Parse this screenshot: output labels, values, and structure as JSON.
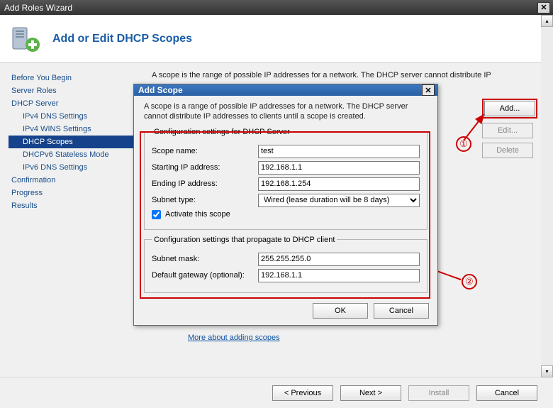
{
  "window": {
    "title": "Add Roles Wizard",
    "header_title": "Add or Edit DHCP Scopes"
  },
  "sidebar": {
    "items": [
      {
        "label": "Before You Begin",
        "sub": false,
        "selected": false
      },
      {
        "label": "Server Roles",
        "sub": false,
        "selected": false
      },
      {
        "label": "DHCP Server",
        "sub": false,
        "selected": false
      },
      {
        "label": "IPv4 DNS Settings",
        "sub": true,
        "selected": false
      },
      {
        "label": "IPv4 WINS Settings",
        "sub": true,
        "selected": false
      },
      {
        "label": "DHCP Scopes",
        "sub": true,
        "selected": true
      },
      {
        "label": "DHCPv6 Stateless Mode",
        "sub": true,
        "selected": false
      },
      {
        "label": "IPv6 DNS Settings",
        "sub": true,
        "selected": false
      },
      {
        "label": "Confirmation",
        "sub": false,
        "selected": false
      },
      {
        "label": "Progress",
        "sub": false,
        "selected": false
      },
      {
        "label": "Results",
        "sub": false,
        "selected": false
      }
    ]
  },
  "main": {
    "intro": "A scope is the range of possible IP addresses for a network. The DHCP server cannot distribute IP",
    "add_label": "Add...",
    "edit_label": "Edit...",
    "delete_label": "Delete",
    "link": "More about adding scopes"
  },
  "footer": {
    "previous": "< Previous",
    "next": "Next >",
    "install": "Install",
    "cancel": "Cancel"
  },
  "annotations": {
    "one": "①",
    "two": "②"
  },
  "dialog": {
    "title": "Add Scope",
    "intro": "A scope is a range of possible IP addresses for a network. The DHCP server cannot distribute IP addresses to clients until a scope is created.",
    "fieldset1_legend": "Configuration settings for DHCP Server",
    "scope_name_label": "Scope name:",
    "scope_name_value": "test",
    "starting_ip_label": "Starting IP address:",
    "starting_ip_value": "192.168.1.1",
    "ending_ip_label": "Ending IP address:",
    "ending_ip_value": "192.168.1.254",
    "subnet_type_label": "Subnet type:",
    "subnet_type_value": "Wired (lease duration will be 8 days)",
    "activate_label": "Activate this scope",
    "activate_checked": true,
    "fieldset2_legend": "Configuration settings that propagate to DHCP client",
    "subnet_mask_label": "Subnet mask:",
    "subnet_mask_value": "255.255.255.0",
    "gateway_label": "Default gateway (optional):",
    "gateway_value": "192.168.1.1",
    "ok": "OK",
    "cancel": "Cancel"
  }
}
